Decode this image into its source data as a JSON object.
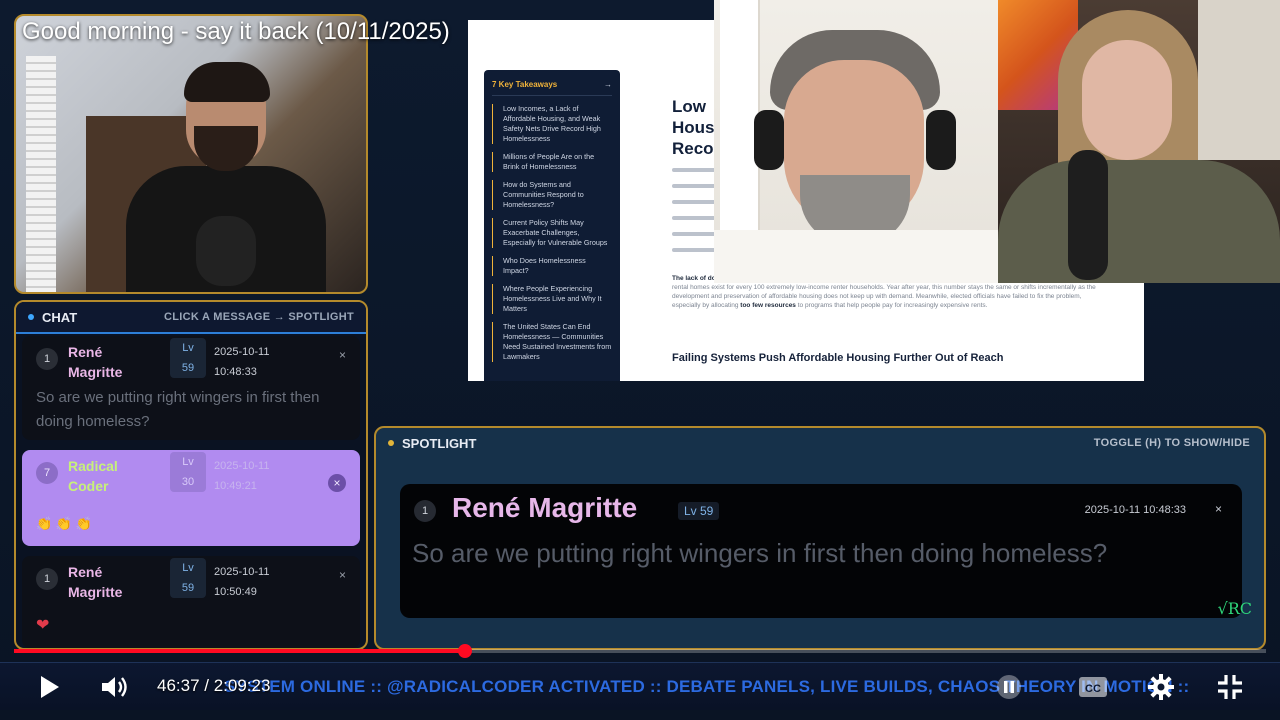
{
  "video": {
    "title": "Good morning - say it back (10/11/2025)"
  },
  "chat": {
    "title": "CHAT",
    "hint": "CLICK A MESSAGE → SPOTLIGHT",
    "messages": [
      {
        "num": "1",
        "name": "René Magritte",
        "lv": "Lv",
        "lv_num": "59",
        "date": "2025-10-11",
        "time": "10:48:33",
        "close": "×",
        "body": "So are we putting right wingers in first then doing homeless?"
      },
      {
        "num": "7",
        "name": "Radical Coder",
        "lv": "Lv",
        "lv_num": "30",
        "date": "2025-10-11",
        "time": "10:49:21",
        "close": "×",
        "body": "👏 👏 👏"
      },
      {
        "num": "1",
        "name": "René Magritte",
        "lv": "Lv",
        "lv_num": "59",
        "date": "2025-10-11",
        "time": "10:50:49",
        "close": "×",
        "body": "❤"
      }
    ]
  },
  "document": {
    "toc_title": "7 Key Takeaways",
    "toc_arrow": "→",
    "toc_items": [
      "Low Incomes, a Lack of Affordable Housing, and Weak Safety Nets Drive Record High Homelessness",
      "Millions of People Are on the Brink of Homelessness",
      "How do Systems and Communities Respond to Homelessness?",
      "Current Policy Shifts May Exacerbate Challenges, Especially for Vulnerable Groups",
      "Who Does Homelessness Impact?",
      "Where People Experiencing Homelessness Live and Why It Matters",
      "The United States Can End Homelessness — Communities Need Sustained Investments from Lawmakers"
    ],
    "title": "Low Hous Reco",
    "paragraph_lead": "The lack of do",
    "paragraph": "choice between paying for housing and other necessities like healthcare, groceries, or clothing. Only 35 affordable and available rental homes exist for every 100 extremely low-income renter households. Year after year, this number stays the same or shifts incrementally as the development and preservation of affordable housing does not keep up with demand. Meanwhile, elected officials have failed to fix the problem, especially by allocating",
    "paragraph_bold": "too few resources",
    "paragraph_tail": "to programs that help people pay for increasingly expensive rents.",
    "heading2": "Failing Systems Push Affordable Housing Further Out of Reach"
  },
  "spotlight": {
    "title": "SPOTLIGHT",
    "hint": "TOGGLE (H) TO SHOW/HIDE",
    "num": "1",
    "name": "René Magritte",
    "lv": "Lv 59",
    "datetime": "2025-10-11 10:48:33",
    "close": "×",
    "body": "So are we putting right wingers in first then doing homeless?",
    "logo": "√RC"
  },
  "player": {
    "current_time": "46:37",
    "separator": " / ",
    "duration": "2:09:23",
    "progress": 0.3602,
    "ticker": "SYSTEM ONLINE :: @RADICALCODER ACTIVATED :: DEBATE PANELS, LIVE BUILDS, CHAOS THEORY IN MOTION ::",
    "accent": "#ff0a22"
  },
  "icons": {
    "play": "play-icon",
    "volume": "volume-icon",
    "pause": "pause-icon",
    "captions": "captions-icon",
    "settings": "gear-icon",
    "exit_fullscreen": "exit-fullscreen-icon"
  }
}
